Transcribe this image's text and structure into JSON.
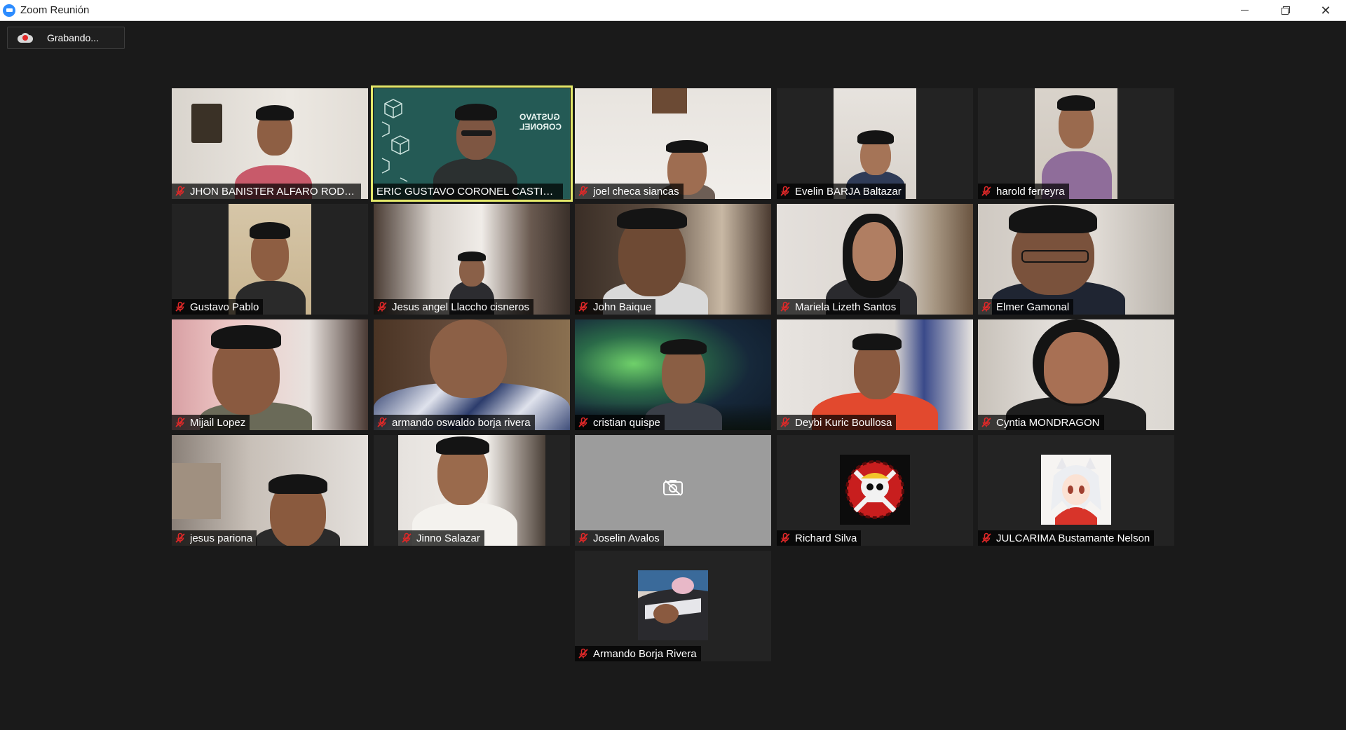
{
  "window": {
    "title": "Zoom Reunión"
  },
  "recording": {
    "label": "Grabando..."
  },
  "colors": {
    "background": "#1a1a1a",
    "active_speaker_border": "#e3e86a",
    "muted_icon": "#e02828",
    "tile_background": "#232323"
  },
  "participants": [
    {
      "name": "JHON BANISTER ALFARO RODRIG...",
      "muted": true,
      "video": "on"
    },
    {
      "name": "ERIC GUSTAVO CORONEL CASTILLO",
      "muted": false,
      "video": "on",
      "active_speaker": true,
      "virtual_background_text": [
        "GUSTAVO",
        "CORONEL"
      ]
    },
    {
      "name": "joel checa siancas",
      "muted": true,
      "video": "on"
    },
    {
      "name": "Evelin BARJA  Baltazar",
      "muted": true,
      "video": "on"
    },
    {
      "name": "harold ferreyra",
      "muted": true,
      "video": "on"
    },
    {
      "name": "Gustavo Pablo",
      "muted": true,
      "video": "on"
    },
    {
      "name": "Jesus angel Llaccho cisneros",
      "muted": true,
      "video": "on"
    },
    {
      "name": "John Baique",
      "muted": true,
      "video": "on"
    },
    {
      "name": "Mariela Lizeth Santos",
      "muted": true,
      "video": "on"
    },
    {
      "name": "Elmer Gamonal",
      "muted": true,
      "video": "on"
    },
    {
      "name": "Mijail Lopez",
      "muted": true,
      "video": "on"
    },
    {
      "name": "armando oswaldo borja rivera",
      "muted": true,
      "video": "on"
    },
    {
      "name": "cristian quispe",
      "muted": true,
      "video": "on"
    },
    {
      "name": "Deybi Kuric Boullosa",
      "muted": true,
      "video": "on"
    },
    {
      "name": "Cyntia MONDRAGON",
      "muted": true,
      "video": "on"
    },
    {
      "name": "jesus pariona",
      "muted": true,
      "video": "on"
    },
    {
      "name": "Jinno Salazar",
      "muted": true,
      "video": "on"
    },
    {
      "name": "Joselin Avalos",
      "muted": true,
      "video": "off",
      "icon": "video-off-icon"
    },
    {
      "name": "Richard Silva",
      "muted": true,
      "video": "avatar",
      "icon": "skull-avatar"
    },
    {
      "name": "JULCARIMA Bustamante Nelson",
      "muted": true,
      "video": "avatar",
      "icon": "anime-avatar"
    },
    {
      "name": "Armando Borja Rivera",
      "muted": true,
      "video": "avatar",
      "icon": "photo-avatar"
    }
  ]
}
